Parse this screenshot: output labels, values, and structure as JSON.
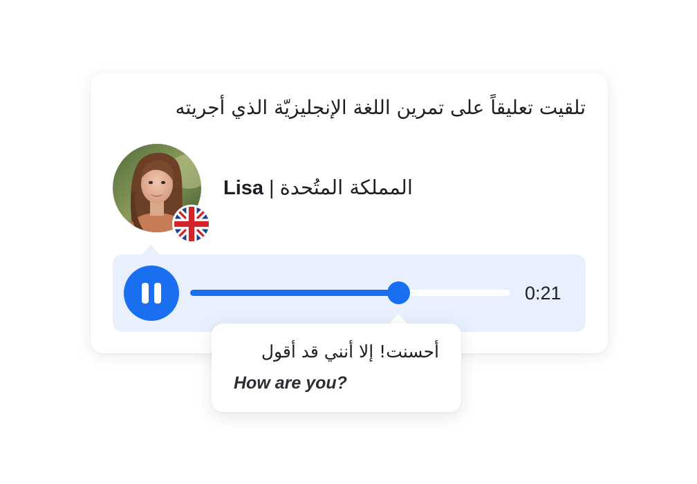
{
  "card": {
    "title": "تلقيت تعليقاً على تمرين اللغة الإنجليزيّة الذي أجريته"
  },
  "speaker": {
    "name": "Lisa",
    "separator": "|",
    "country": "المملكة المتُحدة",
    "avatar_icon": "profile-photo",
    "flag_icon": "uk-flag-icon"
  },
  "player": {
    "state": "playing",
    "button_icon": "pause-icon",
    "progress": 0.65,
    "time": "0:21",
    "accent_color": "#1a6ff0",
    "background_color": "#e8f0fd"
  },
  "feedback": {
    "line1": "أحسنت! إلا أنني قد أقول",
    "line2": "How are you?"
  }
}
